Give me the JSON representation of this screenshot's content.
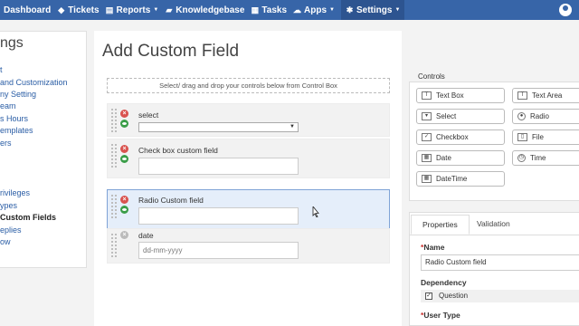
{
  "nav": {
    "items": [
      {
        "label": "Dashboard",
        "icon": "dashboard-icon"
      },
      {
        "label": "Tickets",
        "icon": "tag-icon"
      },
      {
        "label": "Reports",
        "icon": "document-icon"
      },
      {
        "label": "Knowledgebase",
        "icon": "book-icon"
      },
      {
        "label": "Tasks",
        "icon": "calendar-icon"
      },
      {
        "label": "Apps",
        "icon": "cloud-icon"
      },
      {
        "label": "Settings",
        "icon": "gear-icon"
      }
    ],
    "active": "Settings",
    "color": "#3765a8"
  },
  "sidebar": {
    "title": "ngs",
    "items": [
      "t",
      "and Customization",
      "ny Setting",
      "eam",
      "s Hours",
      "emplates",
      "ers",
      "rivileges",
      "ypes",
      "Custom Fields",
      "eplies",
      "ow"
    ],
    "current_index": 9
  },
  "main": {
    "title": "Add Custom Field",
    "drop_hint": "Select/ drag and drop your controls below from Control Box",
    "fields": [
      {
        "label": "select",
        "type": "select",
        "value": ""
      },
      {
        "label": "Check box custom field",
        "type": "text",
        "value": ""
      },
      {
        "label": "Radio Custom field",
        "type": "text",
        "value": ""
      },
      {
        "label": "date",
        "type": "date",
        "value": "dd-mm-yyyy"
      }
    ]
  },
  "controls": {
    "label": "Controls",
    "buttons": [
      {
        "label": "Text Box",
        "icon": "textbox-icon"
      },
      {
        "label": "Text Area",
        "icon": "textarea-icon"
      },
      {
        "label": "Select",
        "icon": "select-icon"
      },
      {
        "label": "Radio",
        "icon": "radio-icon"
      },
      {
        "label": "Checkbox",
        "icon": "checkbox-icon"
      },
      {
        "label": "File",
        "icon": "file-icon"
      },
      {
        "label": "Date",
        "icon": "date-icon"
      },
      {
        "label": "Time",
        "icon": "clock-icon"
      },
      {
        "label": "DateTime",
        "icon": "datetime-icon"
      }
    ]
  },
  "properties": {
    "tabs": [
      "Properties",
      "Validation"
    ],
    "name_label": "Name",
    "name_value": "Radio Custom field",
    "dependency_label": "Dependency",
    "dependency_option": "Question",
    "user_type_label": "User Type"
  }
}
